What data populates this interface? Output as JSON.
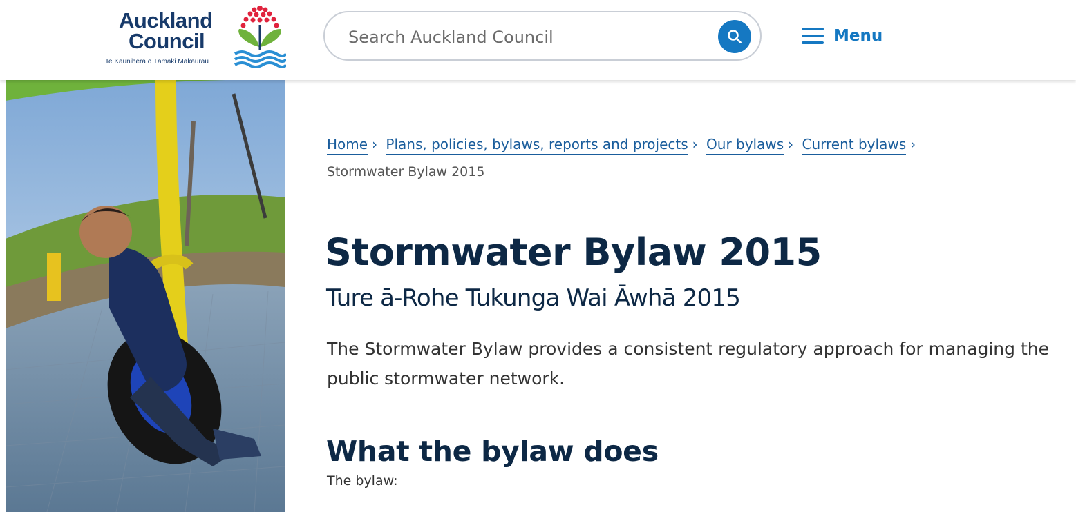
{
  "header": {
    "logo": {
      "line1": "Auckland",
      "line2": "Council",
      "tagline": "Te Kaunihera o Tāmaki Makaurau"
    },
    "search": {
      "placeholder": "Search Auckland Council"
    },
    "menu_label": "Menu"
  },
  "breadcrumb": {
    "items": [
      "Home",
      "Plans, policies, bylaws, reports and projects",
      "Our bylaws",
      "Current bylaws"
    ],
    "current": "Stormwater Bylaw 2015"
  },
  "page": {
    "title": "Stormwater Bylaw 2015",
    "subtitle": "Ture ā-Rohe Tukunga Wai Āwhā 2015",
    "intro": "The Stormwater Bylaw provides a consistent regulatory approach for managing the public stormwater network.",
    "section_heading": "What the bylaw does",
    "section_text": "The bylaw:"
  },
  "colors": {
    "brand_navy": "#0d2845",
    "link_blue": "#1578c2",
    "logo_navy": "#173a6a"
  },
  "icons": {
    "search": "search-icon",
    "menu": "hamburger-icon",
    "logo": "pohutukawa-logo-icon"
  }
}
